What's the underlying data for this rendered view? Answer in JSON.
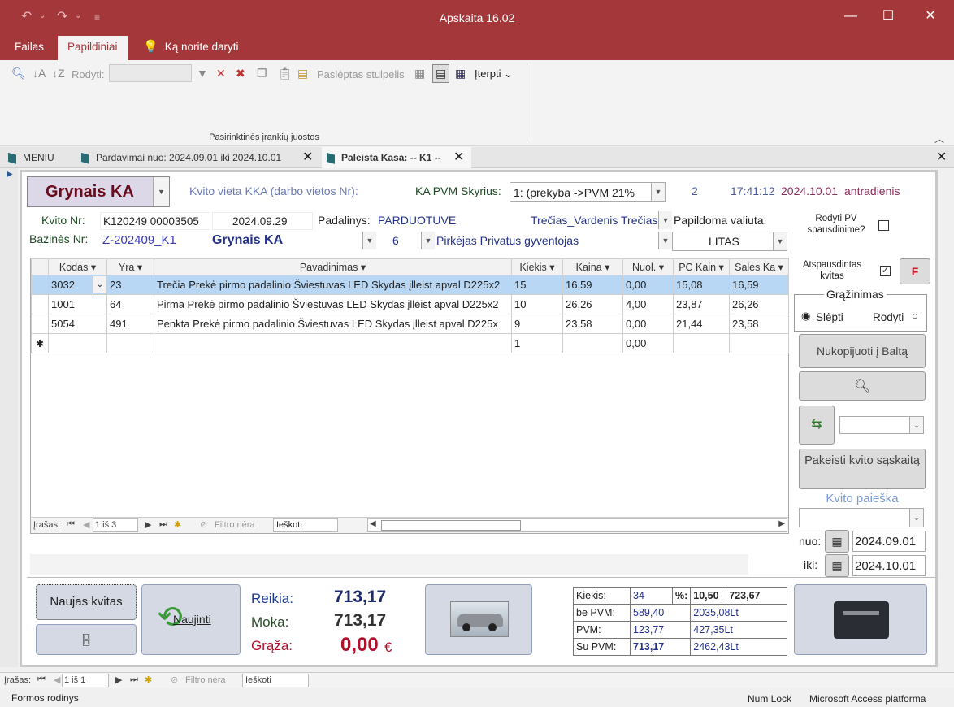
{
  "window": {
    "title": "Apskaita 16.02"
  },
  "ribbon_tabs": [
    "Failas",
    "Papildiniai",
    "Ką norite daryti"
  ],
  "ribbon": {
    "rodyti_label": "Rodyti:",
    "hidden_column_label": "Paslėptas stulpelis",
    "insert_label": "Įterpti",
    "group_label": "Pasirinktinės įrankių juostos"
  },
  "doc_tabs": [
    "MENIU",
    "Pardavimai nuo: 2024.09.01 iki 2024.10.01",
    "Paleista Kasa: -- K1 --"
  ],
  "header": {
    "payment_type": "Grynais KA",
    "kvito_vieta_label": "Kvito vieta KKA (darbo vietos Nr):",
    "pvm_skyrius_label": "KA PVM Skyrius:",
    "pvm_skyrius_value": "1: (prekyba ->PVM 21%",
    "counter": "2",
    "time": "17:41:12",
    "date": "2024.10.01",
    "weekday": "antradienis"
  },
  "receipt": {
    "kvito_nr_label": "Kvito Nr:",
    "kvito_nr": "K120249 00003505",
    "kvito_date": "2024.09.29",
    "padalinys_label": "Padalinys:",
    "padalinys": "PARDUOTUVE",
    "employee": "Trečias_Vardenis Trečias",
    "papildoma_valiuta_label": "Papildoma valiuta:",
    "rodyti_pv_label": "Rodyti PV spausdinime?",
    "bazines_nr_label": "Bazinės Nr:",
    "bazines_nr": "Z-202409_K1",
    "payment2": "Grynais KA",
    "num": "6",
    "buyer": "Pirkėjas Privatus gyventojas",
    "currency": "LITAS"
  },
  "grid": {
    "columns": [
      "Kodas",
      "Yra",
      "Pavadinimas",
      "Kiekis",
      "Kaina",
      "Nuol.",
      "PC Kain",
      "Salės Ka"
    ],
    "rows": [
      [
        "3032",
        "23",
        "Trečia Prekė pirmo padalinio Šviestuvas LED Skydas įlleist apval D225x2",
        "15",
        "16,59",
        "0,00",
        "15,08",
        "16,59"
      ],
      [
        "1001",
        "64",
        "Pirma Prekė pirmo padalinio Šviestuvas LED Skydas įlleist apval D225x2",
        "10",
        "26,26",
        "4,00",
        "23,87",
        "26,26"
      ],
      [
        "5054",
        "491",
        "Penkta Prekė pirmo padalinio Šviestuvas LED Skydas įlleist apval D225x",
        "9",
        "23,58",
        "0,00",
        "21,44",
        "23,58"
      ]
    ],
    "new_row": [
      "",
      "",
      "",
      "1",
      "",
      "0,00",
      "",
      ""
    ],
    "nav": {
      "label": "Įrašas:",
      "position": "1 iš 3",
      "filter": "Filtro nėra",
      "search": "Ieškoti"
    }
  },
  "side": {
    "atspausdintas_label": "Atspausdintas kvitas",
    "f_label": "F",
    "grazinimas_label": "Grąžinimas",
    "slepti_label": "Slėpti",
    "rodyti_label": "Rodyti",
    "copy_button": "Nukopijuoti į Baltą",
    "change_button": "Pakeisti kvito sąskaitą",
    "search_label": "Kvito paieška",
    "nuo_label": "nuo:",
    "nuo_value": "2024.09.01",
    "iki_label": "iki:",
    "iki_value": "2024.10.01"
  },
  "bottom": {
    "new_receipt_button": "Naujas kvitas",
    "refresh_button": "Naujinti",
    "reikia_label": "Reikia:",
    "reikia_value": "713,17",
    "moka_label": "Moka:",
    "moka_value": "713,17",
    "graza_label": "Grąža:",
    "graza_value": "0,00",
    "currency_symbol": "€"
  },
  "summary": {
    "rows": [
      [
        "Kiekis:",
        "34",
        "%:",
        "10,50",
        "723,67"
      ],
      [
        "be PVM:",
        "589,40",
        "2035,08Lt"
      ],
      [
        "PVM:",
        "123,77",
        "427,35Lt"
      ],
      [
        "Su PVM:",
        "713,17",
        "2462,43Lt"
      ]
    ]
  },
  "outer_nav": {
    "label": "Įrašas:",
    "position": "1 iš 1",
    "filter": "Filtro nėra",
    "search": "Ieškoti"
  },
  "statusbar": {
    "left": "Formos rodinys",
    "numlock": "Num Lock",
    "platform": "Microsoft Access platforma"
  },
  "colors": {
    "title_bar": "#a4373a",
    "accent_red": "#b0102a",
    "navy": "#23318a",
    "selection": "#b8d7f5"
  }
}
